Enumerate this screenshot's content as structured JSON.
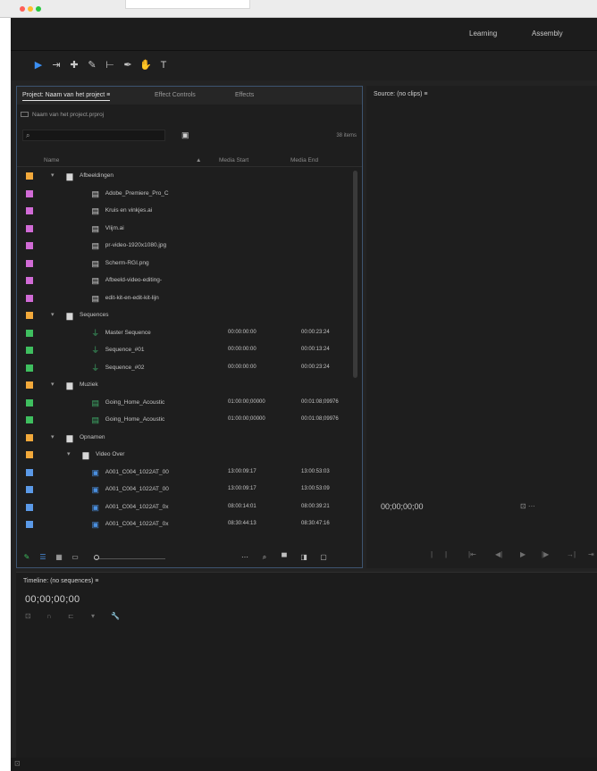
{
  "workspaces": [
    "Learning",
    "Assembly"
  ],
  "tools": [
    {
      "icon": "selection-icon",
      "glyph": "▶",
      "active": true
    },
    {
      "icon": "track-select-icon",
      "glyph": "⇥"
    },
    {
      "icon": "ripple-edit-icon",
      "glyph": "✚"
    },
    {
      "icon": "razor-icon",
      "glyph": "✎"
    },
    {
      "icon": "slip-icon",
      "glyph": "⊢"
    },
    {
      "icon": "pen-icon",
      "glyph": "✒"
    },
    {
      "icon": "hand-icon",
      "glyph": "✋"
    },
    {
      "icon": "type-icon",
      "glyph": "T"
    }
  ],
  "project": {
    "tabs": [
      "Project: Naam van het project  ≡",
      "Effect Controls",
      "Effects"
    ],
    "file": "Naam van het project.prproj",
    "search_value": "",
    "items_count": "38 items",
    "columns": {
      "name": "Name",
      "sort": "▲",
      "media_start": "Media Start",
      "media_end": "Media End"
    },
    "rows": [
      {
        "type": "folder",
        "indent": 0,
        "label": "#f2a93b",
        "name": "Afbeeldingen",
        "start": "",
        "end": ""
      },
      {
        "type": "file",
        "indent": 1,
        "label": "#d16bd6",
        "name": "Adobe_Premiere_Pro_C",
        "start": "",
        "end": ""
      },
      {
        "type": "file",
        "indent": 1,
        "label": "#d16bd6",
        "name": "Kruis en vinkjes.ai",
        "start": "",
        "end": ""
      },
      {
        "type": "file",
        "indent": 1,
        "label": "#d16bd6",
        "name": "Vlijm.ai",
        "start": "",
        "end": ""
      },
      {
        "type": "file",
        "indent": 1,
        "label": "#d16bd6",
        "name": "pr-video-1920x1080.jpg",
        "start": "",
        "end": ""
      },
      {
        "type": "file",
        "indent": 1,
        "label": "#d16bd6",
        "name": "Scherm-RGI.png",
        "start": "",
        "end": ""
      },
      {
        "type": "file",
        "indent": 1,
        "label": "#d16bd6",
        "name": "Afbeeld-video-editing-",
        "start": "",
        "end": ""
      },
      {
        "type": "file",
        "indent": 1,
        "label": "#d16bd6",
        "name": "edit-kit-en-edit-kit-lijn",
        "start": "",
        "end": ""
      },
      {
        "type": "folder",
        "indent": 0,
        "label": "#f2a93b",
        "name": "Sequences",
        "start": "",
        "end": ""
      },
      {
        "type": "sequence",
        "indent": 1,
        "label": "#3fbf5f",
        "name": "Master Sequence",
        "start": "00:00:00:00",
        "end": "00:00:23:24"
      },
      {
        "type": "sequence",
        "indent": 1,
        "label": "#3fbf5f",
        "name": "Sequence_#01",
        "start": "00:00:00:00",
        "end": "00:00:13:24"
      },
      {
        "type": "sequence",
        "indent": 1,
        "label": "#3fbf5f",
        "name": "Sequence_#02",
        "start": "00:00:00:00",
        "end": "00:00:23:24"
      },
      {
        "type": "folder",
        "indent": 0,
        "label": "#f2a93b",
        "name": "Muziek",
        "start": "",
        "end": ""
      },
      {
        "type": "clip",
        "indent": 1,
        "label": "#3fbf5f",
        "name": "Going_Home_Acoustic",
        "start": "01:00:00;00000",
        "end": "00:01:08;09976"
      },
      {
        "type": "clip",
        "indent": 1,
        "label": "#3fbf5f",
        "name": "Going_Home_Acoustic",
        "start": "01:00:00;00000",
        "end": "00:01:08;09976"
      },
      {
        "type": "folder",
        "indent": 0,
        "label": "#f2a93b",
        "name": "Opnamen",
        "start": "",
        "end": ""
      },
      {
        "type": "folder",
        "indent": 1,
        "label": "#f2a93b",
        "name": "Video Over",
        "start": "",
        "end": ""
      },
      {
        "type": "video",
        "indent": 1,
        "label": "#5b9ae8",
        "name": "A001_C004_1022AT_00",
        "start": "13:00:09:17",
        "end": "13:00:53:03"
      },
      {
        "type": "video",
        "indent": 1,
        "label": "#5b9ae8",
        "name": "A001_C004_1022AT_00",
        "start": "13:00:09:17",
        "end": "13:00:53:09"
      },
      {
        "type": "video",
        "indent": 1,
        "label": "#5b9ae8",
        "name": "A001_C004_1022AT_0x",
        "start": "08:00:14:01",
        "end": "08:00:39:21"
      },
      {
        "type": "video",
        "indent": 1,
        "label": "#5b9ae8",
        "name": "A001_C004_1022AT_0x",
        "start": "08:30:44:13",
        "end": "08:30:47:16"
      }
    ]
  },
  "source": {
    "tab": "Source: (no clips)  ≡",
    "timecode": "00;00;00;00",
    "settings_glyph": "⊡  ···",
    "transport": [
      "|",
      "|",
      "|⇤",
      "◀|",
      "▶",
      "|▶",
      "→|",
      "⇥"
    ]
  },
  "timeline": {
    "tab": "Timeline: (no sequences)  ≡",
    "timecode": "00;00;00;00",
    "tools": [
      {
        "glyph": "⊡"
      },
      {
        "glyph": "∩"
      },
      {
        "glyph": "⊏"
      },
      {
        "glyph": "▾"
      },
      {
        "glyph": "🔧",
        "wrench": true
      }
    ]
  },
  "statusbar": {
    "icon": "⊡"
  }
}
